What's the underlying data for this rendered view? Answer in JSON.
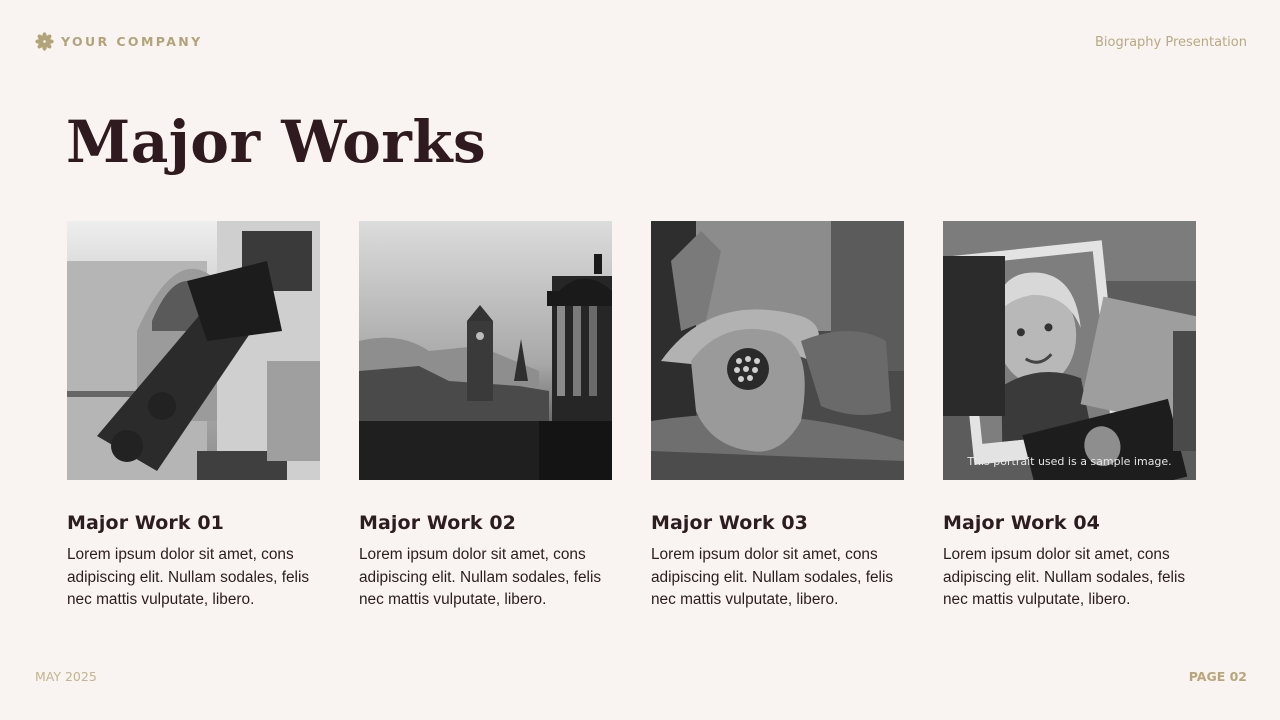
{
  "header": {
    "brand_name": "YOUR COMPANY",
    "brand_icon": "flower-icon",
    "right_label": "Biography Presentation"
  },
  "title": "Major Works",
  "works": [
    {
      "title": "Major Work 01",
      "description": "Lorem ipsum dolor sit amet,  cons adipiscing elit. Nullam sodales, felis nec mattis vulputate, libero.",
      "image": "train-wreck-photo"
    },
    {
      "title": "Major Work 02",
      "description": "Lorem ipsum dolor sit amet,  cons adipiscing elit. Nullam sodales, felis nec mattis vulputate, libero.",
      "image": "city-skyline-photo"
    },
    {
      "title": "Major Work 03",
      "description": "Lorem ipsum dolor sit amet,  cons adipiscing elit. Nullam sodales, felis nec mattis vulputate, libero.",
      "image": "gladiator-helmet-photo"
    },
    {
      "title": "Major Work 04",
      "description": "Lorem ipsum dolor sit amet,  cons adipiscing elit. Nullam sodales, felis nec mattis vulputate, libero.",
      "image": "portrait-collage-photo",
      "caption": "This portrait used is a sample image."
    }
  ],
  "footer": {
    "date": "MAY 2025",
    "page": "PAGE 02"
  },
  "colors": {
    "background": "#f9f3f1",
    "accent": "#b1a479",
    "title": "#2f1b1f"
  }
}
